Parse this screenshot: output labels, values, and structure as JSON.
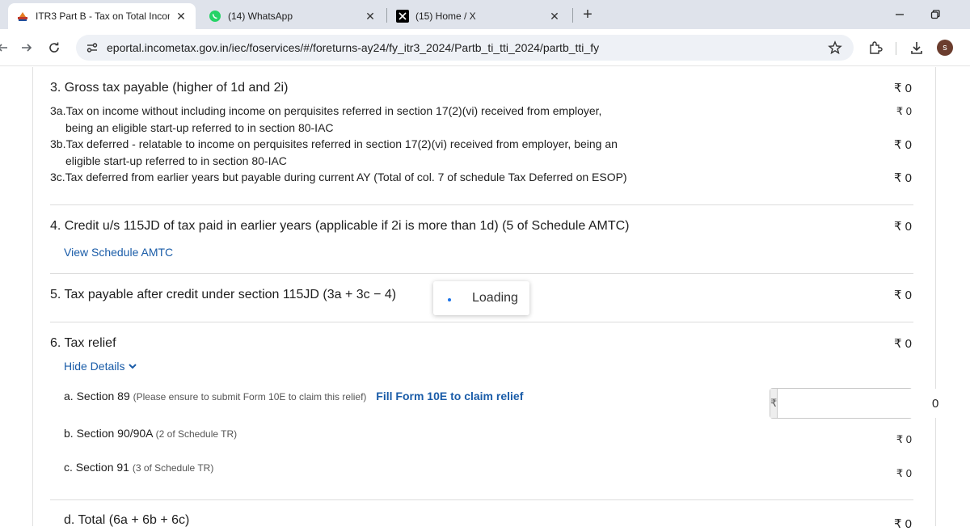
{
  "browser": {
    "tabs": [
      {
        "title": "ITR3 Part B - Tax on Total Incom",
        "icon": "emblem-icon",
        "active": true
      },
      {
        "title": "(14) WhatsApp",
        "icon": "whatsapp-icon",
        "active": false
      },
      {
        "title": "(15) Home / X",
        "icon": "x-icon",
        "active": false
      }
    ],
    "new_tab": "+",
    "url": "eportal.incometax.gov.in/iec/foservices/#/foreturns-ay24/fy_itr3_2024/Partb_ti_tti_2024/partb_tti_fy",
    "avatar_letter": "s"
  },
  "sections": {
    "s3": {
      "title": "3. Gross tax payable (higher of 1d and 2i)",
      "amount": "₹ 0",
      "a_line1": "3a.Tax on income without including income on perquisites referred in section 17(2)(vi) received from employer,",
      "a_line2": "being an eligible start-up referred to in section 80-IAC",
      "a_amount": "₹ 0",
      "b_line1": "3b.Tax deferred - relatable to income on perquisites referred in section 17(2)(vi) received from employer, being an",
      "b_line2": "eligible start-up referred to in section 80-IAC",
      "b_amount": "₹ 0",
      "c_line1": "3c.Tax deferred from earlier years but payable during current AY (Total of col. 7 of schedule Tax Deferred on ESOP)",
      "c_amount": "₹ 0"
    },
    "s4": {
      "title": "4. Credit u/s 115JD of tax paid in earlier years (applicable if 2i is more than 1d) (5 of Schedule AMTC)",
      "amount": "₹ 0",
      "link": "View Schedule AMTC"
    },
    "s5": {
      "title": "5. Tax payable after credit under section 115JD (3a + 3c − 4)",
      "amount": "₹ 0"
    },
    "s6": {
      "title": "6. Tax relief",
      "amount": "₹ 0",
      "toggle": "Hide Details",
      "a_label": "a. Section 89",
      "a_note": "(Please ensure to submit Form 10E to claim this relief)",
      "a_link": "Fill Form 10E to claim relief",
      "a_prefix": "₹",
      "a_value": "0",
      "b_label": "b. Section 90/90A",
      "b_note": "(2 of Schedule TR)",
      "b_amount": "₹ 0",
      "c_label": "c. Section 91",
      "c_note": "(3 of Schedule TR)",
      "c_amount": "₹ 0",
      "d_label": "d. Total (6a + 6b + 6c)",
      "d_amount": "₹ 0"
    }
  },
  "loading": {
    "text": "Loading"
  }
}
